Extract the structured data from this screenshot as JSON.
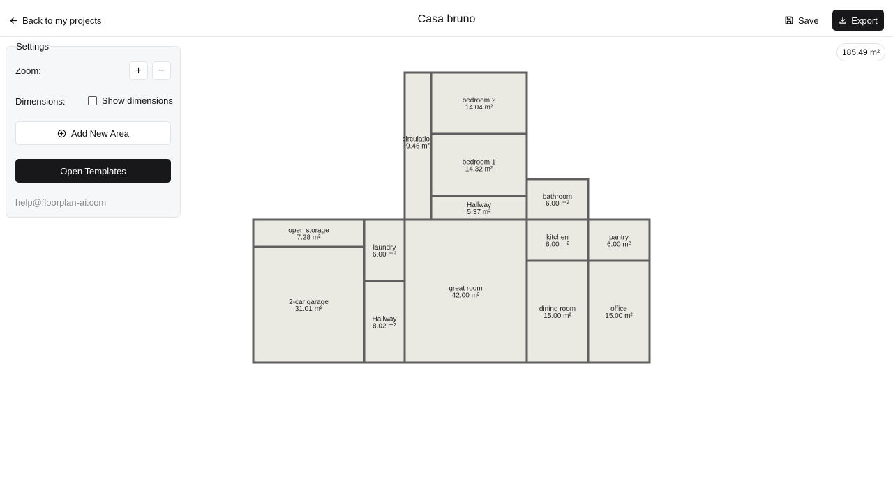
{
  "header": {
    "back_label": "Back to my projects",
    "title": "Casa bruno",
    "save_label": "Save",
    "export_label": "Export"
  },
  "settings": {
    "legend": "Settings",
    "zoom_label": "Zoom:",
    "zoom_in": "+",
    "zoom_out": "−",
    "dimensions_label": "Dimensions:",
    "show_dimensions_label": "Show dimensions",
    "show_dimensions_checked": false,
    "add_area_label": "Add New Area",
    "templates_label": "Open Templates",
    "help_email": "help@floorplan-ai.com"
  },
  "total_area": "185.49 m²",
  "colors": {
    "room_fill": "#eaeae3",
    "wall_stroke": "#5f5f5f",
    "primary_button": "#18181b"
  },
  "floorplan": {
    "rooms": [
      {
        "id": "circulation",
        "name": "circulation",
        "area": "9.46 m²"
      },
      {
        "id": "bedroom-2",
        "name": "bedroom 2",
        "area": "14.04 m²"
      },
      {
        "id": "bedroom-1",
        "name": "bedroom 1",
        "area": "14.32 m²"
      },
      {
        "id": "hallway-upper",
        "name": "Hallway",
        "area": "5.37 m²"
      },
      {
        "id": "bathroom",
        "name": "bathroom",
        "area": "6.00 m²"
      },
      {
        "id": "open-storage",
        "name": "open storage",
        "area": "7.28 m²"
      },
      {
        "id": "garage",
        "name": "2-car garage",
        "area": "31.01 m²"
      },
      {
        "id": "laundry",
        "name": "laundry",
        "area": "6.00 m²"
      },
      {
        "id": "hallway-lower",
        "name": "Hallway",
        "area": "8.02 m²"
      },
      {
        "id": "great-room",
        "name": "great room",
        "area": "42.00 m²"
      },
      {
        "id": "kitchen",
        "name": "kitchen",
        "area": "6.00 m²"
      },
      {
        "id": "pantry",
        "name": "pantry",
        "area": "6.00 m²"
      },
      {
        "id": "dining-room",
        "name": "dining room",
        "area": "15.00 m²"
      },
      {
        "id": "office",
        "name": "office",
        "area": "15.00 m²"
      }
    ]
  }
}
